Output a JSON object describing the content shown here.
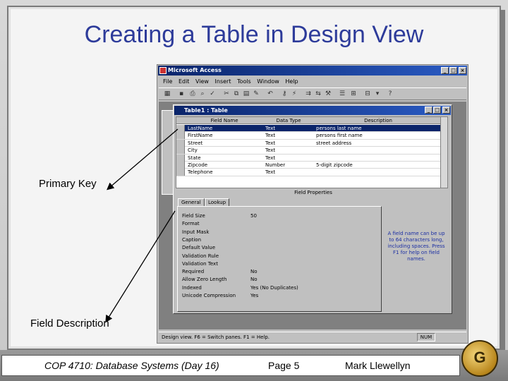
{
  "slide": {
    "title": "Creating a Table in Design View",
    "callouts": {
      "primary_key": "Primary Key",
      "field_description": "Field Description"
    },
    "footer": {
      "course": "COP 4710: Database Systems  (Day 16)",
      "page": "Page 5",
      "author": "Mark Llewellyn"
    }
  },
  "access": {
    "window_title": "Microsoft Access",
    "menu": [
      "File",
      "Edit",
      "View",
      "Insert",
      "Tools",
      "Window",
      "Help"
    ],
    "table_window_title": "Table1 : Table",
    "columns": [
      "Field Name",
      "Data Type",
      "Description"
    ],
    "rows": [
      {
        "field": "LastName",
        "type": "Text",
        "desc": "persons last name",
        "selected": true
      },
      {
        "field": "FirstName",
        "type": "Text",
        "desc": "persons first name",
        "selected": false
      },
      {
        "field": "Street",
        "type": "Text",
        "desc": "street address",
        "selected": false
      },
      {
        "field": "City",
        "type": "Text",
        "desc": "",
        "selected": false
      },
      {
        "field": "State",
        "type": "Text",
        "desc": "",
        "selected": false
      },
      {
        "field": "Zipcode",
        "type": "Number",
        "desc": "5-digit zipcode",
        "selected": false
      },
      {
        "field": "Telephone",
        "type": "Text",
        "desc": "",
        "selected": false
      }
    ],
    "field_properties_label": "Field Properties",
    "tabs": [
      "General",
      "Lookup"
    ],
    "properties": [
      {
        "name": "Field Size",
        "value": "50"
      },
      {
        "name": "Format",
        "value": ""
      },
      {
        "name": "Input Mask",
        "value": ""
      },
      {
        "name": "Caption",
        "value": ""
      },
      {
        "name": "Default Value",
        "value": ""
      },
      {
        "name": "Validation Rule",
        "value": ""
      },
      {
        "name": "Validation Text",
        "value": ""
      },
      {
        "name": "Required",
        "value": "No"
      },
      {
        "name": "Allow Zero Length",
        "value": "No"
      },
      {
        "name": "Indexed",
        "value": "Yes (No Duplicates)"
      },
      {
        "name": "Unicode Compression",
        "value": "Yes"
      }
    ],
    "help_text": "A field name can be up to 64 characters long, including spaces. Press F1 for help on field names.",
    "status_text": "Design view.  F6 = Switch panes.  F1 = Help.",
    "status_num": "NUM"
  }
}
